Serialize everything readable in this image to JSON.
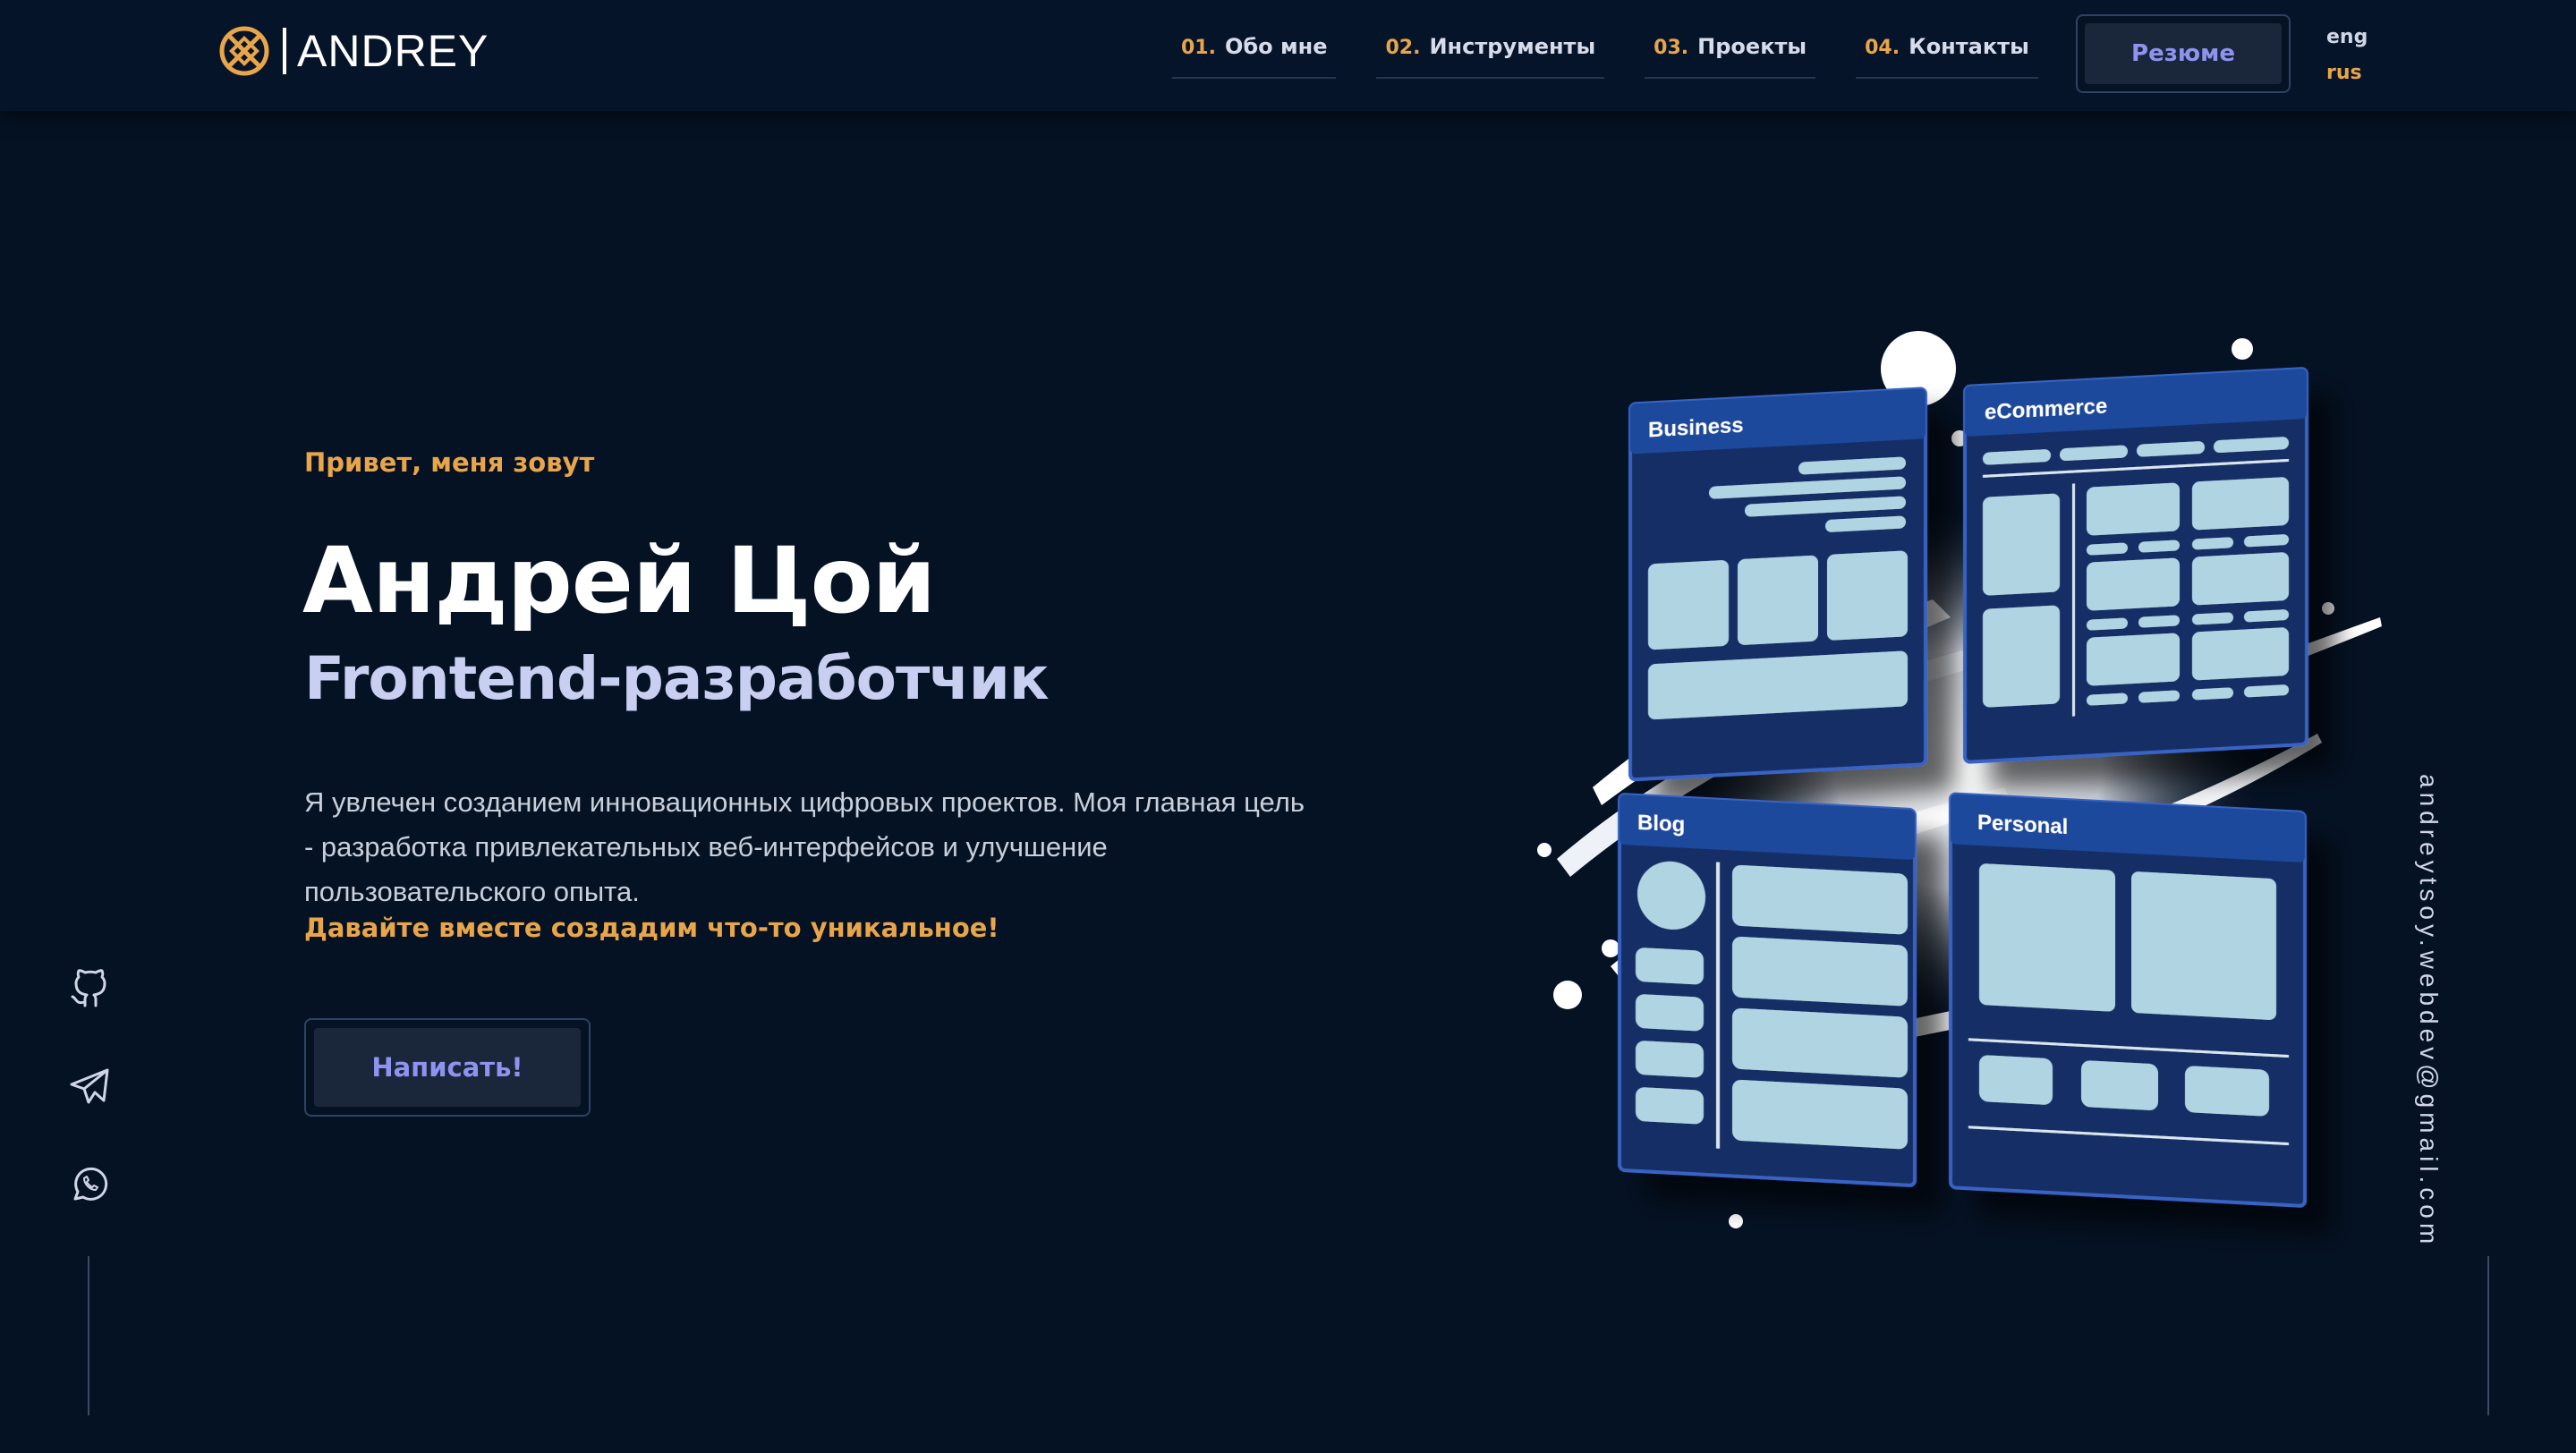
{
  "header": {
    "logo_text": "ANDREY",
    "nav": [
      {
        "num": "01.",
        "label": "Обо мне"
      },
      {
        "num": "02.",
        "label": "Инструменты"
      },
      {
        "num": "03.",
        "label": "Проекты"
      },
      {
        "num": "04.",
        "label": "Контакты"
      }
    ],
    "resume_label": "Резюме",
    "lang": {
      "eng": "eng",
      "rus": "rus"
    }
  },
  "hero": {
    "greeting": "Привет, меня зовут",
    "name": "Андрей Цой",
    "role": "Frontend-разработчик",
    "description": "Я увлечен созданием инновационных цифровых проектов. Моя главная цель - разработка привлекательных веб-интерфейсов и улучшение пользовательского опыта.",
    "cta": "Давайте вместе создадим что-то уникальное!",
    "write_button": "Написать!"
  },
  "social": [
    "github-icon",
    "telegram-icon",
    "whatsapp-icon"
  ],
  "email": "andreytsoy.webdev@gmail.com",
  "illustration": {
    "cards": [
      "Business",
      "eCommerce",
      "Blog",
      "Personal"
    ]
  },
  "colors": {
    "background": "#051224",
    "accent": "#e8a54a",
    "button_text": "#8f93f0",
    "card_blue": "#1d3f86",
    "card_block": "#b1d4e3"
  }
}
